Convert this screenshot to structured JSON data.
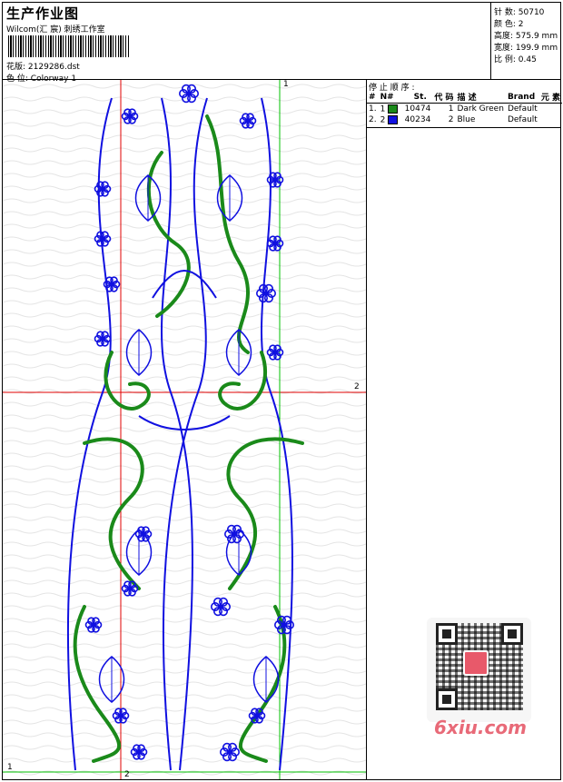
{
  "header": {
    "title": "生产作业图",
    "company": "Wilcom(汇 宸) 刺绣工作室",
    "design_label": "花版:",
    "design_value": "2129286.dst",
    "colorway_label": "色 位:",
    "colorway_value": "Colorway 1"
  },
  "stats": [
    {
      "label": "针 数:",
      "value": "50710"
    },
    {
      "label": "颜 色:",
      "value": "2"
    },
    {
      "label": "高度:",
      "value": "575.9 mm"
    },
    {
      "label": "宽度:",
      "value": "199.9 mm"
    },
    {
      "label": "比 例:",
      "value": "0.45"
    }
  ],
  "stop_sequence": {
    "title": "停 止 顺 序 :",
    "columns": [
      "#",
      "N#",
      "St.",
      "代 码",
      "描 述",
      "Brand",
      "元 素"
    ],
    "rows": [
      {
        "num": "1.",
        "n": "1",
        "color": "#1a8a1a",
        "st": "10474",
        "code": "1",
        "desc": "Dark Green",
        "brand": "Default"
      },
      {
        "num": "2.",
        "n": "2",
        "color": "#1010e0",
        "st": "40234",
        "code": "2",
        "desc": "Blue",
        "brand": "Default"
      }
    ]
  },
  "axis_labels": {
    "top": "1",
    "right": "2",
    "bottom_left": "1",
    "bottom_red": "2"
  },
  "colors": {
    "green_thread": "#1a8a1a",
    "blue_thread": "#1010e0",
    "red_axis": "#e00000",
    "green_axis": "#00c000"
  },
  "watermark": "6xiu.com"
}
